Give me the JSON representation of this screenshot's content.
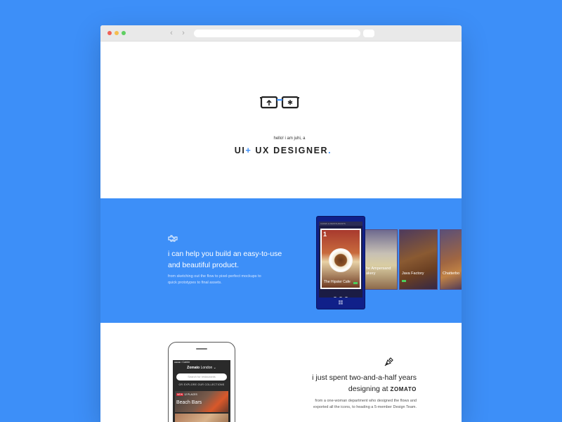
{
  "browser": {
    "back_label": "‹",
    "forward_label": "›"
  },
  "hero": {
    "hello": "hello! i am juhi, a",
    "headline_ui": "UI",
    "headline_plus": "+",
    "headline_rest": " UX DESIGNER",
    "headline_period": "."
  },
  "help": {
    "line1": "i can help you build an easy-to-use",
    "line2": "and beautiful product.",
    "sub1": "from sketching out the flow to pixel-perfect mockups to",
    "sub2": "quick prototypes to final assets."
  },
  "wp_mockup": {
    "topbar": "CAFES & RESTAURANTS",
    "card_number": "1",
    "main_caption": "The Hipster Cafe",
    "cards": [
      {
        "caption_line1": "he Ampersand",
        "caption_line2": "akery"
      },
      {
        "caption_line1": "Java Factory",
        "caption_line2": ""
      },
      {
        "caption_line1": "Chatterbo",
        "caption_line2": ""
      }
    ]
  },
  "zomato_mockup": {
    "status": "●●●●○ Carrier",
    "title_brand": "Zomato",
    "title_city": " London ⌄",
    "search_placeholder": "Search for restaurants",
    "collections_label": "OR EXPLORE OUR COLLECTIONS",
    "card_tag": "NEW",
    "card_tag_rest": "12 PLACES",
    "card_name": "Beach Bars"
  },
  "career": {
    "line1": "i just spent two-and-a-half years",
    "line2": "designing at ",
    "brand": "ZOMATO",
    "sub1": "from a one-woman department who designed the flows and",
    "sub2": "exported all the icons, to heading a 5-member Design Team."
  },
  "colors": {
    "accent": "#3d8ff8",
    "background": "#3d8ff8"
  }
}
